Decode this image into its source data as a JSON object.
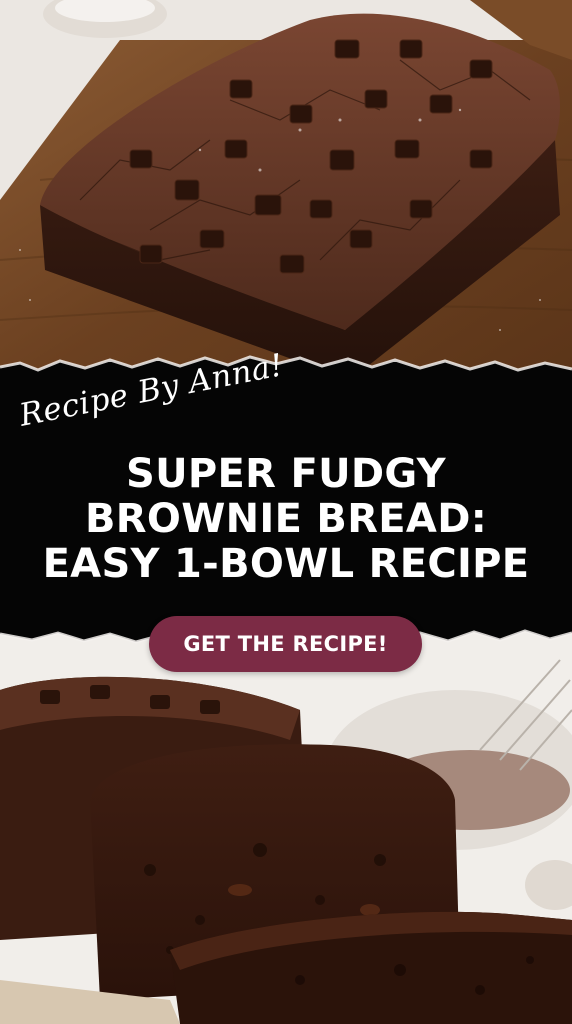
{
  "byline": "Recipe By Anna!",
  "headline": {
    "line1": "SUPER FUDGY",
    "line2": "BROWNIE BREAD:",
    "line3": "EASY 1-BOWL RECIPE"
  },
  "cta_label": "GET THE RECIPE!",
  "colors": {
    "band": "#050505",
    "cta": "#7c2b45",
    "text": "#ffffff"
  },
  "images": {
    "top": "brownie-loaf-on-wooden-board",
    "bottom": "sliced-brownie-bread"
  }
}
